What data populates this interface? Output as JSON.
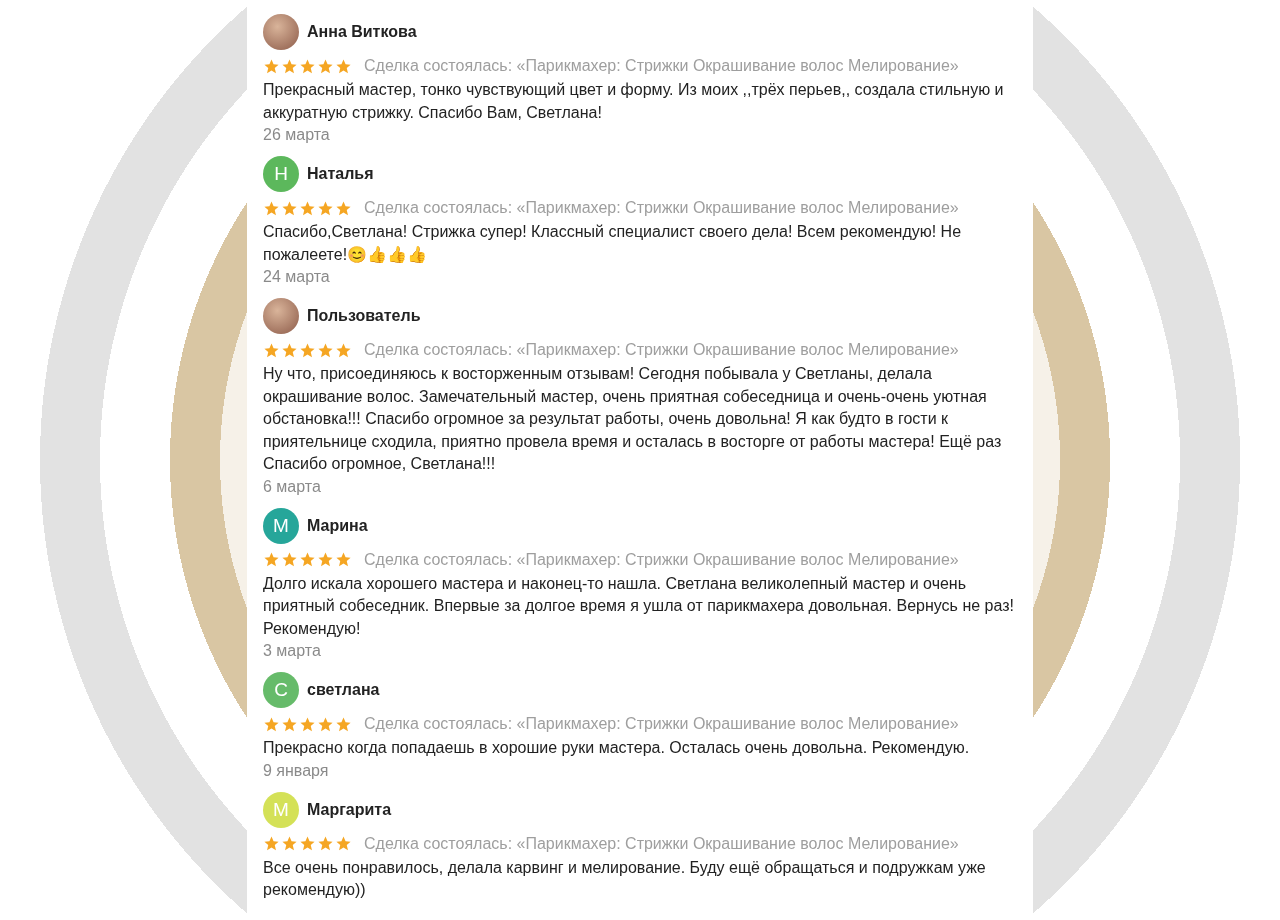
{
  "reviews": [
    {
      "author": "Анна Виткова",
      "avatar": {
        "kind": "photo"
      },
      "stars": 5,
      "deal": "Сделка состоялась: «Парикмахер: Стрижки Окрашивание волос Мелирование»",
      "text": "Прекрасный мастер, тонко чувствующий цвет и форму. Из моих ,,трёх перьев,, создала стильную и аккуратную стрижку. Спасибо Вам, Светлана!",
      "date": "26 марта"
    },
    {
      "author": "Наталья",
      "avatar": {
        "kind": "letter",
        "letter": "Н",
        "color": "#5cb85c"
      },
      "stars": 5,
      "deal": "Сделка состоялась: «Парикмахер: Стрижки Окрашивание волос Мелирование»",
      "text": "Спасибо,Светлана! Стрижка супер! Классный специалист своего дела! Всем рекомендую! Не пожалеете!😊👍👍👍",
      "date": "24 марта"
    },
    {
      "author": "Пользователь",
      "avatar": {
        "kind": "photo"
      },
      "stars": 5,
      "deal": "Сделка состоялась: «Парикмахер: Стрижки Окрашивание волос Мелирование»",
      "text": "Ну что, присоединяюсь к восторженным отзывам! Сегодня побывала у Светланы, делала окрашивание волос. Замечательный мастер, очень приятная собеседница и очень-очень уютная обстановка!!! Спасибо огромное за результат работы, очень довольна! Я как будто в гости к приятельнице сходила, приятно провела время и осталась в восторге от работы мастера! Ещё раз Спасибо огромное, Светлана!!!",
      "date": "6 марта"
    },
    {
      "author": "Марина",
      "avatar": {
        "kind": "letter",
        "letter": "М",
        "color": "#26a69a"
      },
      "stars": 5,
      "deal": "Сделка состоялась: «Парикмахер: Стрижки Окрашивание волос Мелирование»",
      "text": "Долго искала хорошего мастера и наконец-то нашла. Светлана великолепный мастер и очень приятный собеседник. Впервые за долгое время я ушла от парикмахера довольная. Вернусь не раз! Рекомендую!",
      "date": "3 марта"
    },
    {
      "author": "светлана",
      "avatar": {
        "kind": "letter",
        "letter": "С",
        "color": "#66bb6a"
      },
      "stars": 5,
      "deal": "Сделка состоялась: «Парикмахер: Стрижки Окрашивание волос Мелирование»",
      "text": "Прекрасно когда попадаешь в хорошие руки мастера. Осталась очень довольна. Рекомендую.",
      "date": "9 января"
    },
    {
      "author": "Маргарита",
      "avatar": {
        "kind": "letter",
        "letter": "М",
        "color": "#d4e157"
      },
      "stars": 5,
      "deal": "Сделка состоялась: «Парикмахер: Стрижки Окрашивание волос Мелирование»",
      "text": "Все очень понравилось, делала карвинг и мелирование. Буду ещё обращаться и подружкам уже рекомендую))"
    }
  ]
}
